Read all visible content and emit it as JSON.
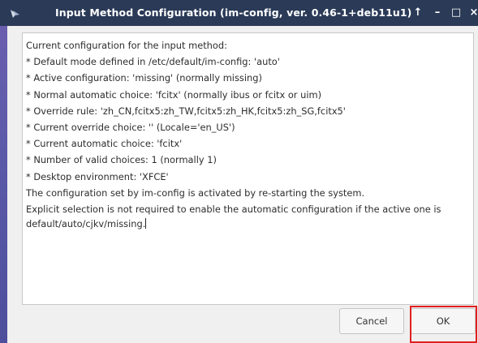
{
  "titlebar": {
    "title": "Input Method Configuration (im-config, ver. 0.46-1+deb11u1)",
    "icons": {
      "app": "keyboard-icon",
      "up": "up-arrow-icon",
      "minimize": "minimize-icon",
      "maximize": "maximize-icon",
      "close": "close-icon"
    },
    "up_glyph": "↑",
    "min_glyph": "–",
    "max_glyph": "□",
    "close_glyph": "×"
  },
  "message": {
    "lines": [
      "Current configuration for the input method:",
      " * Default mode defined in /etc/default/im-config: 'auto'",
      " * Active configuration: 'missing' (normally missing)",
      " * Normal automatic choice: 'fcitx' (normally ibus or fcitx or uim)",
      " * Override rule: 'zh_CN,fcitx5:zh_TW,fcitx5:zh_HK,fcitx5:zh_SG,fcitx5'",
      " * Current override choice: '' (Locale='en_US')",
      " * Current automatic choice: 'fcitx'",
      " * Number of valid choices: 1 (normally 1)",
      " * Desktop environment: 'XFCE'",
      "The configuration set by im-config is activated by re-starting the system."
    ],
    "last_paragraph": "Explicit selection is not required to enable the automatic configuration if the active one is default/auto/cjkv/missing."
  },
  "buttons": {
    "cancel": "Cancel",
    "ok": "OK"
  },
  "colors": {
    "titlebar": "#2a3a57",
    "highlight": "#e02020",
    "side_strip": "#5b5aa9"
  }
}
